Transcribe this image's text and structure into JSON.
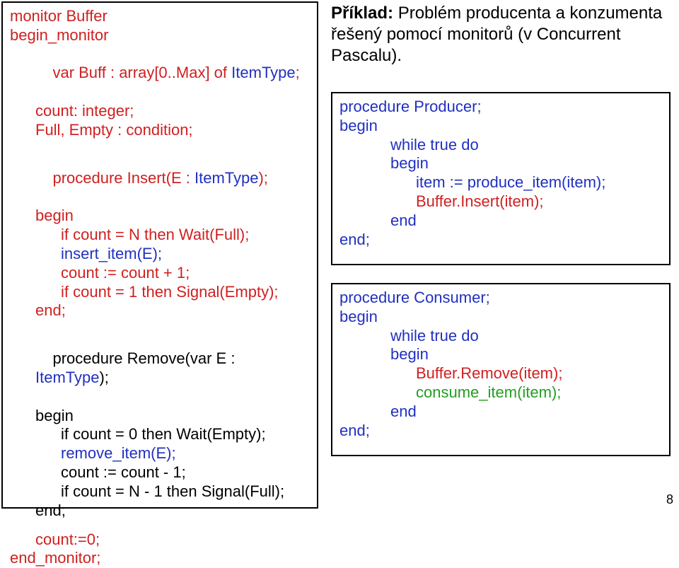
{
  "left": {
    "l1": "monitor Buffer",
    "l2": "begin_monitor",
    "l3a": "var Buff : array[0..Max] of ",
    "l3b": "ItemType",
    "l3c": ";",
    "l4": "count: integer;",
    "l5": "Full, Empty : condition;",
    "l6a": "procedure Insert(E : ",
    "l6b": "ItemType",
    "l6c": ");",
    "l7": "begin",
    "l8": "if count = N then Wait(Full);",
    "l9": "insert_item(E);",
    "l10": "count := count + 1;",
    "l11": "if count = 1 then Signal(Empty);",
    "l12": "end;",
    "l13a": "procedure Remove(var E : ",
    "l13b": "ItemType",
    "l13c": ");",
    "l14": "begin",
    "l15": "if count = 0 then Wait(Empty);",
    "l16": "remove_item(E);",
    "l17": "count := count - 1;",
    "l18": "if count = N - 1 then Signal(Full);",
    "l19": "end;",
    "l20": "count:=0;",
    "l21": "end_monitor;"
  },
  "right_title": {
    "t1a": "Příklad:",
    "t1b": " Problém producenta a konzumenta řešený pomocí monitorů (v Concurrent Pascalu)."
  },
  "prod": {
    "l1": "procedure Producer;",
    "l2": "begin",
    "l3": "while true do",
    "l4": "begin",
    "l5": "item := produce_item(item);",
    "l6": "Buffer.Insert(item);",
    "l7": "end",
    "l8": "end;"
  },
  "cons": {
    "l1": "procedure Consumer;",
    "l2": "begin",
    "l3": "while true do",
    "l4": "begin",
    "l5": "Buffer.Remove(item);",
    "l6": "consume_item(item);",
    "l7": "end",
    "l8": "end;"
  },
  "page_num": "8"
}
